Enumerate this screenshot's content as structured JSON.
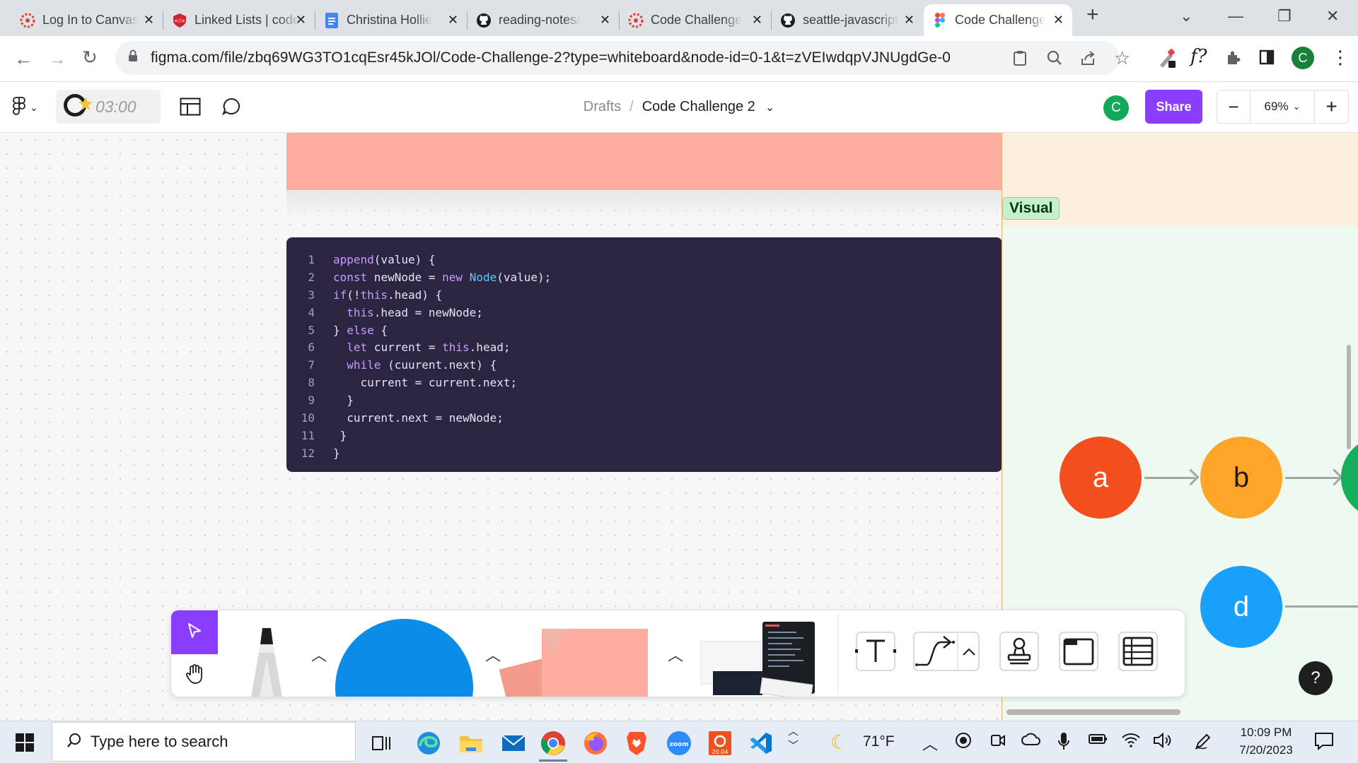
{
  "browser": {
    "tabs": [
      {
        "title": "Log In to Canvas",
        "icon": "canvas-icon"
      },
      {
        "title": "Linked Lists | code",
        "icon": "codefellows-icon"
      },
      {
        "title": "Christina Hollie",
        "icon": "docs-icon"
      },
      {
        "title": "reading-notes/",
        "icon": "github-icon"
      },
      {
        "title": "Code Challenge",
        "icon": "canvas-icon"
      },
      {
        "title": "seattle-javascript",
        "icon": "github-icon"
      },
      {
        "title": "Code Challenge",
        "icon": "figma-icon",
        "active": true
      }
    ],
    "url": "figma.com/file/zbq69WG3TO1cqEsr45kJOl/Code-Challenge-2?type=whiteboard&node-id=0-1&t=zVEIwdqpVJNUgdGe-0",
    "profile_initial": "C"
  },
  "figma": {
    "timer": "03:00",
    "breadcrumb": {
      "parent": "Drafts",
      "separator": "/",
      "file": "Code Challenge 2"
    },
    "avatar_initial": "C",
    "share_label": "Share",
    "zoom": "69%",
    "zoom_minus": "−",
    "zoom_plus": "+"
  },
  "code": {
    "lines": [
      "append(value) {",
      "const newNode = new Node(value);",
      "if(!this.head) {",
      "  this.head = newNode;",
      "} else {",
      "  let current = this.head;",
      "  while (cuurent.next) {",
      "    current = current.next;",
      "  }",
      "  current.next = newNode;",
      " }",
      "}"
    ]
  },
  "visual": {
    "label": "Visual",
    "nodes": [
      {
        "label": "a",
        "color": "#f24e1e"
      },
      {
        "label": "b",
        "color": "#ffa629"
      },
      {
        "label": "d",
        "color": "#18a0fb"
      }
    ]
  },
  "help_label": "?",
  "taskbar": {
    "search_placeholder": "Type here to search",
    "weather": "71°F",
    "time": "10:09 PM",
    "date": "7/20/2023"
  },
  "colors": {
    "figma_accent": "#8b3dff",
    "code_bg": "#2c2541",
    "sticky": "#ffada0"
  }
}
